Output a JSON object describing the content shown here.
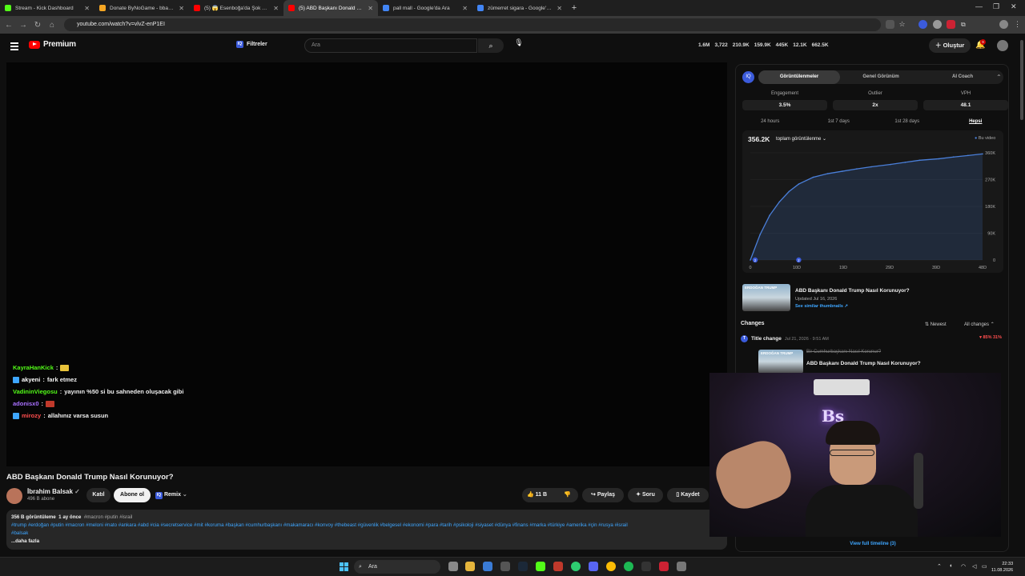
{
  "tabs": [
    {
      "label": "Stream - Kick Dashboard",
      "color": "#53fc18",
      "active": false
    },
    {
      "label": "Donate ByNoGame - bbasho D...",
      "color": "#f5a623",
      "active": false
    },
    {
      "label": "(5) 😱 Esenboğa'da Şok Anları!",
      "color": "#ff0000",
      "active": false
    },
    {
      "label": "(5) ABD Başkanı Donald Trump",
      "color": "#ff0000",
      "active": true
    },
    {
      "label": "pall mall - Google'da Ara",
      "color": "#4285f4",
      "active": false
    },
    {
      "label": "zümerret sigara - Google'da Ar",
      "color": "#4285f4",
      "active": false
    }
  ],
  "newtab": "+",
  "url": "youtube.com/watch?v=vlvZ-enP1EI",
  "header": {
    "brand": "Premium",
    "filters_label": "Filtreler",
    "search_placeholder": "Ara",
    "stats": [
      "1.6M",
      "3,722",
      "210.9K",
      "159.9K",
      "445K",
      "12.1K",
      "662.5K"
    ],
    "create_label": "Oluştur",
    "notif_count": "9"
  },
  "chat": [
    {
      "user": "KayraHanKick",
      "color": "#53fc18",
      "text": "",
      "emote": "#e8c23a"
    },
    {
      "user": "akyeni",
      "color": "#ffffff",
      "text": "fark etmez",
      "emote": null,
      "badge": true
    },
    {
      "user": "VadininViegosu",
      "color": "#53fc18",
      "text": "yayının %50 si bu sahneden oluşacak gibi",
      "emote": null
    },
    {
      "user": "adonisx0",
      "color": "#a970ff",
      "text": "",
      "emote": "#c0392b"
    },
    {
      "user": "mirozy",
      "color": "#ff4d4d",
      "text": "allahınız varsa susun",
      "emote": null,
      "badge": true
    }
  ],
  "video": {
    "title": "ABD Başkanı Donald Trump Nasıl Korunuyor?",
    "channel": "İbrahim Balsak",
    "subs": "496 B abone",
    "join": "Katıl",
    "subscribe": "Abone ol",
    "remix": "Remix",
    "likes": "11 B",
    "share": "Paylaş",
    "ask": "Soru",
    "save": "Kaydet"
  },
  "description": {
    "views": "356 B görüntüleme",
    "age": "1 ay önce",
    "head_tags": "#macron #putin #israil",
    "tags": "#trump #erdoğan #putin #macron #meloni #nato #ankara #abd #cia #secretservice #mit #koruma #başkan #cumhurbaşkanı #makamaracı #konvoy #thebeast #güvenlik #belgesel #ekonomi #para #tarih #psikoloji #siyaset #dünya #finans #marka #türkiye #amerika #çin #rusya #israil",
    "tags2": "#balsak",
    "more": "...daha fazla"
  },
  "panel": {
    "tabs": [
      "Görüntülenmeler",
      "Genel Görünüm",
      "AI Coach"
    ],
    "active_tab": 0,
    "metrics": [
      {
        "label": "Engagement",
        "value": "3.5%"
      },
      {
        "label": "Outlier",
        "value": "2x"
      },
      {
        "label": "VPH",
        "value": "48.1"
      }
    ],
    "periods": [
      "24 hours",
      "1st 7 days",
      "1st 28 days",
      "Hepsi"
    ],
    "active_period": 3,
    "total": "356.2K",
    "total_select": "toplam görüntülenme",
    "legend": "Bu video",
    "card_title": "ABD Başkanı Donald Trump Nasıl Korunuyor?",
    "card_updated": "Updated Jul 16, 2026",
    "card_link": "See similar thumbnails ↗",
    "thumb_text": "ERDOĞAN TRUMP",
    "changes_title": "Changes",
    "sort_label": "Newest",
    "all_changes": "All changes",
    "change_type": "Title change",
    "change_date": "Jul 21, 2026 · 9:51 AM",
    "change_pct": "▾ 85% 31%",
    "old_title": "Bir Cumhurbaşkanı Nasıl Korunur?",
    "new_title": "ABD Başkanı Donald Trump Nasıl Korunuyor?",
    "view_full": "View full timeline (3)"
  },
  "chart_data": {
    "type": "area",
    "x_ticks": [
      "0",
      "10D",
      "19D",
      "29D",
      "39D",
      "48D"
    ],
    "y_ticks": [
      "0",
      "90K",
      "180K",
      "270K",
      "360K"
    ],
    "ylim": [
      0,
      360000
    ],
    "xlim": [
      0,
      48
    ],
    "series": [
      {
        "name": "Bu video",
        "color": "#4a7fd9",
        "x": [
          0,
          2,
          4,
          6,
          8,
          10,
          13,
          16,
          19,
          22,
          25,
          29,
          32,
          35,
          39,
          42,
          45,
          48
        ],
        "y": [
          0,
          85000,
          150000,
          195000,
          230000,
          255000,
          278000,
          290000,
          298000,
          306000,
          313000,
          321000,
          328000,
          335000,
          340000,
          346000,
          351000,
          356200
        ]
      }
    ],
    "markers": [
      {
        "x": 1,
        "label": "2"
      },
      {
        "x": 10,
        "label": "2"
      }
    ]
  },
  "taskbar": {
    "search": "Ara",
    "time": "22:33",
    "date": "11.08.2026"
  }
}
